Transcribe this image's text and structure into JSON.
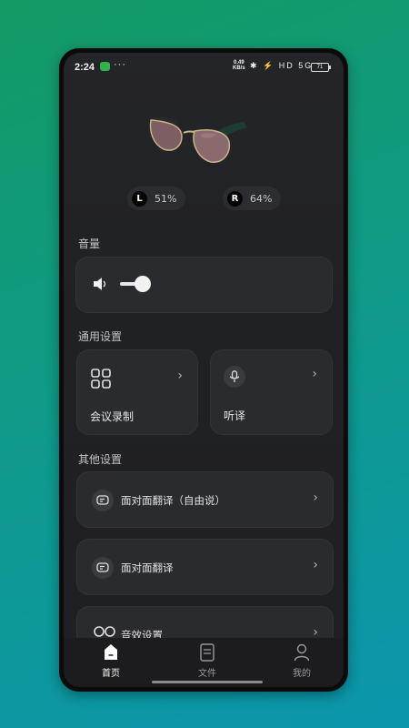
{
  "status_bar": {
    "time": "2:24",
    "dots": "···",
    "net_speed_value": "0.49",
    "net_speed_unit": "KB/s",
    "icons": "✱ ⚡ HD 5G",
    "battery": "71"
  },
  "device": {
    "left_label": "L",
    "left_battery": "51%",
    "right_label": "R",
    "right_battery": "64%"
  },
  "volume": {
    "title": "音量",
    "level": 0.3
  },
  "general": {
    "title": "通用设置",
    "meeting_label": "会议录制",
    "listen_label": "听译"
  },
  "other": {
    "title": "其他设置",
    "items": [
      {
        "label": "面对面翻译（自由说）"
      },
      {
        "label": "面对面翻译"
      },
      {
        "label": "音效设置"
      }
    ]
  },
  "tabbar": {
    "home": "首页",
    "files": "文件",
    "mine": "我的"
  },
  "colors": {
    "accent_bg": "#0f9a86",
    "card": "#2a2b2e"
  }
}
